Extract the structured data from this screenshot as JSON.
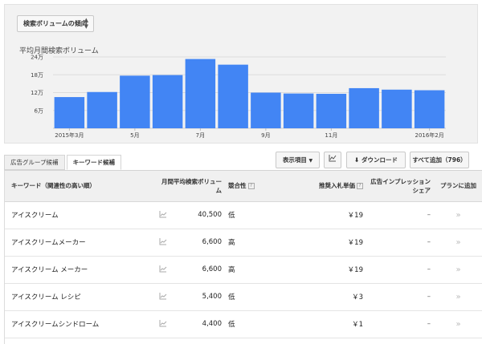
{
  "metric_selector": {
    "label": "検索ボリュームの傾向"
  },
  "chart_data": {
    "type": "bar",
    "title": "平均月間検索ボリューム",
    "x_tick_labels": [
      "2015年3月",
      "5月",
      "7月",
      "9月",
      "11月",
      "2016年2月"
    ],
    "y_ticks": [
      6,
      12,
      18,
      24
    ],
    "y_tick_labels": [
      "6万",
      "12万",
      "18万",
      "24万"
    ],
    "ylim": [
      0,
      24
    ],
    "values": [
      10.5,
      12.2,
      17.7,
      17.9,
      23.3,
      21.4,
      12.0,
      11.7,
      11.6,
      13.5,
      13.0,
      12.8
    ],
    "bar_color": "#4285f4",
    "grid": true
  },
  "tabs": [
    {
      "label": "広告グループ候補",
      "active": false
    },
    {
      "label": "キーワード候補",
      "active": true
    }
  ],
  "toolbar": {
    "columns_label": "表示項目",
    "chart_icon": "line-chart-icon",
    "download_label": "ダウンロード",
    "add_all_label": "すべて追加（796）"
  },
  "table": {
    "headers": {
      "keyword": "キーワード（関連性の高い順）",
      "volume": "月間平均検索ボリューム",
      "competition": "競合性",
      "bid": "推奨入札単価",
      "share": "広告インプレッションシェア",
      "plan": "プランに追加"
    },
    "rows": [
      {
        "keyword": "アイスクリーム",
        "volume": "40,500",
        "competition": "低",
        "bid": "￥19",
        "share": "–"
      },
      {
        "keyword": "アイスクリームメーカー",
        "volume": "6,600",
        "competition": "高",
        "bid": "￥19",
        "share": "–"
      },
      {
        "keyword": "アイスクリーム メーカー",
        "volume": "6,600",
        "competition": "高",
        "bid": "￥19",
        "share": "–"
      },
      {
        "keyword": "アイスクリーム レシピ",
        "volume": "5,400",
        "competition": "低",
        "bid": "￥3",
        "share": "–"
      },
      {
        "keyword": "アイスクリームシンドローム",
        "volume": "4,400",
        "competition": "低",
        "bid": "￥1",
        "share": "–"
      }
    ]
  }
}
